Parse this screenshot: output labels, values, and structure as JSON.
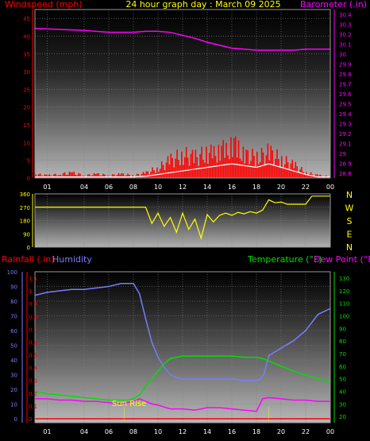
{
  "title": "24 hour graph day : March 09 2025",
  "colors": {
    "wind": "#ff0000",
    "gust": "#ff0000",
    "avg": "#ffffff",
    "baro": "#ff00ff",
    "dir": "#ffff00",
    "hum": "#7b7bff",
    "temp": "#00e000",
    "dew": "#ff00ff",
    "rain": "#ff0000",
    "axisTick": "#ffff00",
    "grid": "#808080"
  },
  "x_ticks": [
    "01",
    "04",
    "06",
    "08",
    "10",
    "12",
    "14",
    "16",
    "18",
    "20",
    "22",
    "00"
  ],
  "chart_data": [
    {
      "type": "line",
      "name": "wind-baro",
      "left_label": "Windspeed (mph)",
      "right_label": "Barometer (.in)",
      "left_ticks": [
        "45",
        "40",
        "35",
        "30",
        "25",
        "20",
        "15",
        "10",
        "5",
        "0"
      ],
      "right_ticks": [
        "30.4",
        "30.3",
        "30.2",
        "30.1",
        "30",
        "29.9",
        "29.8",
        "29.7",
        "29.6",
        "29.5",
        "29.4",
        "29.3",
        "29.2",
        "29.1",
        "29",
        "28.9",
        "28.8"
      ],
      "ylim_left": [
        0,
        47.5
      ],
      "ylim_right": [
        28.75,
        30.45
      ],
      "xlim_hours": [
        0,
        24
      ],
      "barometer": {
        "x": [
          0,
          2,
          4,
          6,
          8,
          9,
          10,
          11,
          12,
          13,
          14,
          15,
          16,
          17,
          18,
          19,
          20,
          21,
          22,
          23,
          24
        ],
        "y": [
          30.26,
          30.25,
          30.24,
          30.22,
          30.22,
          30.23,
          30.23,
          30.22,
          30.19,
          30.16,
          30.12,
          30.09,
          30.06,
          30.05,
          30.04,
          30.04,
          30.04,
          30.04,
          30.05,
          30.05,
          30.05
        ]
      },
      "wind_max": {
        "x": [
          0,
          1,
          2,
          3,
          4,
          5,
          6,
          7,
          8,
          9,
          10,
          11,
          12,
          13,
          14,
          14.5,
          15,
          15.5,
          16,
          16.5,
          17,
          18,
          19,
          20,
          21,
          22,
          23,
          24
        ],
        "y": [
          1.5,
          1,
          1.5,
          2,
          1,
          1.5,
          1,
          1.5,
          1,
          2,
          4,
          7,
          9,
          8,
          10,
          9,
          12,
          10,
          14,
          11,
          9,
          8,
          10,
          7,
          5,
          2,
          1,
          0.5
        ]
      },
      "wind_avg": {
        "x": [
          0,
          2,
          4,
          6,
          8,
          9,
          10,
          11,
          12,
          13,
          14,
          15,
          16,
          17,
          18,
          19,
          20,
          21,
          22,
          23,
          24
        ],
        "y": [
          0.3,
          0.3,
          0.3,
          0.3,
          0.3,
          0.5,
          1,
          1.5,
          2,
          2.5,
          3,
          3.5,
          4,
          3.5,
          3,
          4,
          3,
          2,
          1,
          0.3,
          0.3
        ]
      }
    },
    {
      "type": "line",
      "name": "wind-direction",
      "left_ticks": [
        "360",
        "270",
        "180",
        "90",
        "0"
      ],
      "right_labels": [
        "N",
        "W",
        "S",
        "E",
        "N"
      ],
      "ylim": [
        0,
        360
      ],
      "xlim_hours": [
        0,
        24
      ],
      "direction": {
        "x": [
          0,
          4,
          8,
          9,
          9.5,
          10,
          10.5,
          11,
          11.5,
          12,
          12.5,
          13,
          13.5,
          14,
          14.5,
          15,
          15.5,
          16,
          16.5,
          17,
          17.5,
          18,
          18.5,
          19,
          19.5,
          20,
          20.5,
          21,
          22,
          22.5,
          23,
          24
        ],
        "y": [
          270,
          270,
          270,
          270,
          160,
          230,
          140,
          200,
          100,
          230,
          120,
          190,
          60,
          220,
          170,
          215,
          230,
          215,
          235,
          225,
          240,
          230,
          250,
          320,
          300,
          305,
          290,
          290,
          290,
          345,
          345,
          345
        ]
      }
    },
    {
      "type": "line",
      "name": "rain-humidity-temperature",
      "labels": {
        "rain": "Rainfall (.in)",
        "humidity": "Humidity",
        "temp": "Temperature (°F)",
        "dew": "Dew Point (°F)"
      },
      "annotation": "Sun Rise",
      "hum_ticks": [
        "100",
        "90",
        "80",
        "70",
        "60",
        "50",
        "40",
        "30",
        "20",
        "10",
        "0"
      ],
      "rain_ticks": [
        "1.1",
        "1",
        "0.9",
        "0.8",
        "0.7",
        "0.6",
        "0.5",
        "0.4",
        "0.3",
        "0.2",
        "0.1",
        "0"
      ],
      "temp_ticks": [
        "130",
        "120",
        "110",
        "100",
        "90",
        "80",
        "70",
        "60",
        "50",
        "40",
        "30",
        "20"
      ],
      "ylim_hum": [
        0,
        100
      ],
      "ylim_temp": [
        15,
        135
      ],
      "xlim_hours": [
        0,
        24
      ],
      "humidity": {
        "x": [
          0,
          1,
          2,
          3,
          4,
          5,
          6,
          7,
          8,
          8.5,
          9,
          9.5,
          10,
          10.5,
          11,
          11.5,
          12,
          13,
          14,
          15,
          16,
          17,
          18,
          18.3,
          18.6,
          19,
          20,
          21,
          22,
          23,
          24
        ],
        "y": [
          84,
          86,
          87,
          88,
          88,
          89,
          90,
          92,
          92,
          85,
          68,
          52,
          42,
          35,
          30,
          28,
          27,
          27,
          27,
          27,
          27,
          26,
          26,
          27,
          30,
          43,
          48,
          53,
          60,
          71,
          75
        ]
      },
      "temperature": {
        "x": [
          0,
          1,
          2,
          3,
          4,
          5,
          6,
          7,
          7.5,
          8,
          8.5,
          9,
          9.5,
          10,
          10.5,
          11,
          12,
          13,
          14,
          15,
          16,
          17,
          18,
          18.5,
          19,
          20,
          21,
          22,
          23,
          24
        ],
        "y": [
          40,
          38,
          37,
          36,
          35,
          34,
          33,
          33,
          33,
          34,
          37,
          44,
          50,
          56,
          62,
          66,
          68,
          68,
          68,
          68,
          68,
          67,
          67,
          66,
          64,
          60,
          56,
          53,
          50,
          48
        ]
      },
      "dew_point": {
        "x": [
          0,
          1,
          2,
          3,
          4,
          5,
          6,
          7,
          7.5,
          8,
          8.5,
          9,
          9.5,
          10,
          11,
          12,
          13,
          14,
          15,
          16,
          17,
          18,
          18.5,
          19,
          20,
          21,
          22,
          23,
          24
        ],
        "y": [
          34,
          34,
          33,
          33,
          32,
          32,
          31,
          30,
          31,
          32,
          34,
          32,
          30,
          29,
          26,
          26,
          25,
          27,
          27,
          26,
          25,
          24,
          34,
          35,
          34,
          33,
          33,
          32,
          32
        ]
      },
      "rainfall": {
        "x": [
          0,
          24
        ],
        "y": [
          0,
          0
        ]
      },
      "sunrise_hour": 7.25,
      "sunset_hour": 19.0
    }
  ]
}
